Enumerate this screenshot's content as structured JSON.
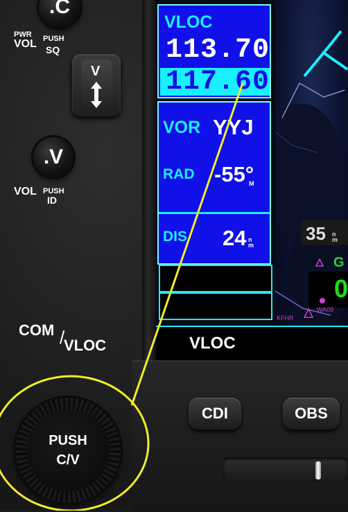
{
  "left_panel": {
    "com_knob_label": ".C",
    "pwr_label": "PWR",
    "vol_label_top": "VOL",
    "push_label_top": "PUSH",
    "sq_label": "SQ",
    "rocker_label": "V",
    "vloc_knob_label": ".V",
    "vol_label_bottom": "VOL",
    "push_label_bottom": "PUSH",
    "id_label": "ID",
    "com_label": "COM",
    "slash": "/",
    "vloc_label": "VLOC",
    "big_knob_line1": "PUSH",
    "big_knob_line2": "C/V"
  },
  "nav_window": {
    "title": "VLOC",
    "active_freq": "113.70",
    "standby_freq": "117.60"
  },
  "station_window": {
    "vor_label": "VOR",
    "vor_id": "YYJ",
    "rad_label": "RAD",
    "rad_value": "-55°",
    "rad_unit": "M",
    "dis_label": "DIS",
    "dis_value": "24",
    "dis_unit_top": "n",
    "dis_unit_bottom": "m"
  },
  "map": {
    "range_value": "35",
    "range_unit_top": "n",
    "range_unit_bottom": "m",
    "label_g": "G",
    "label_green": "0",
    "wpt_1": "KFHR",
    "wpt_2": "WA09"
  },
  "mode_bar": {
    "label": "VLOC"
  },
  "buttons": {
    "cdi": "CDI",
    "obs": "OBS"
  },
  "colors": {
    "screen_blue": "#1010e8",
    "cyan": "#19f0ff",
    "highlight": "#f2ee2a"
  }
}
